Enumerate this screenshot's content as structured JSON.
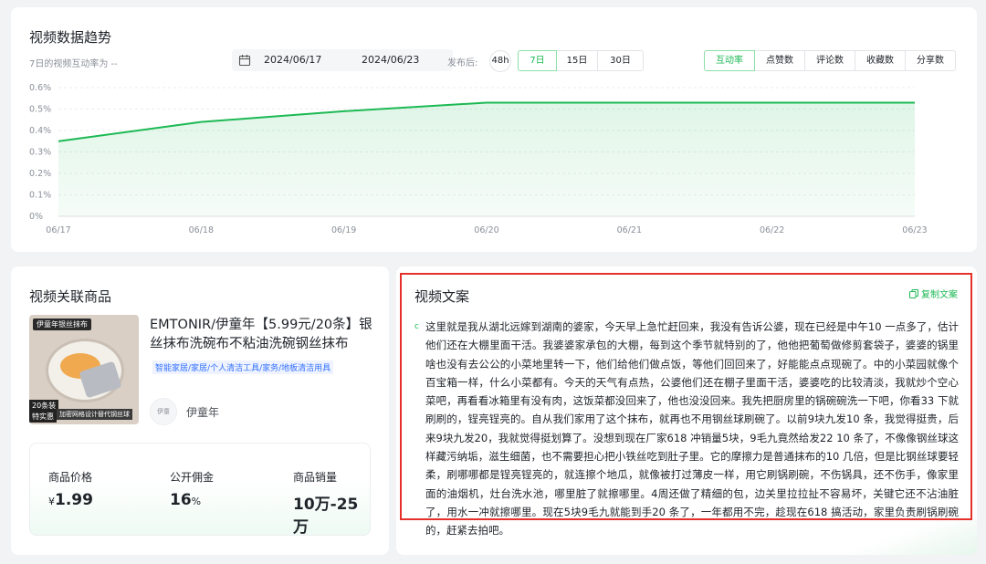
{
  "trend": {
    "title": "视频数据趋势",
    "subtitle": "7日的视频互动率为 --",
    "date_start": "2024/06/17",
    "date_end": "2024/06/23",
    "publish_label": "发布后:",
    "publish_48h": "48h",
    "ranges": [
      "7日",
      "15日",
      "30日"
    ],
    "metrics": [
      "互动率",
      "点赞数",
      "评论数",
      "收藏数",
      "分享数"
    ]
  },
  "chart_data": {
    "type": "area",
    "categories": [
      "06/17",
      "06/18",
      "06/19",
      "06/20",
      "06/21",
      "06/22",
      "06/23"
    ],
    "series": [
      {
        "values": [
          0.35,
          0.44,
          0.49,
          0.53,
          0.53,
          0.53,
          0.53
        ]
      }
    ],
    "y_ticks": [
      "0%",
      "0.1%",
      "0.2%",
      "0.3%",
      "0.4%",
      "0.5%",
      "0.6%"
    ],
    "ylim": [
      0,
      0.6
    ],
    "grid": true,
    "color": "#1db954"
  },
  "product": {
    "title": "视频关联商品",
    "name": "EMTONIR/伊童年【5.99元/20条】银丝抹布洗碗布不粘油洗碗钢丝抹布",
    "category": "智能家居/家居/个人清洁工具/家务/地板清洁用具",
    "thumb": {
      "tag": "伊童年银丝抹布",
      "badge1": "20条装",
      "badge2": "特实惠",
      "badge3": "加密网格设计替代钢丝球"
    },
    "shop_icon_text": "伊童",
    "shop_name": "伊童年",
    "stats": [
      {
        "label": "商品价格",
        "prefix": "¥",
        "value": "1.99",
        "suffix": ""
      },
      {
        "label": "公开佣金",
        "prefix": "",
        "value": "16",
        "suffix": "%"
      },
      {
        "label": "商品销量",
        "prefix": "",
        "value": "10万-25万",
        "suffix": ""
      }
    ]
  },
  "copy": {
    "title": "视频文案",
    "copy_button": "复制文案",
    "dot": "c",
    "text": "这里就是我从湖北远嫁到湖南的婆家，今天早上急忙赶回来，我没有告诉公婆，现在已经是中午10 一点多了，估计他们还在大棚里面干活。我婆婆家承包的大棚，每到这个季节就特别的了，他他把葡萄做修剪套袋子，婆婆的锅里啥也没有去公公的小菜地里转一下，他们给他们做点饭，等他们回回来了，好能能点点现碗了。中的小菜园就像个百宝箱一样，什么小菜都有。今天的天气有点热，公婆他们还在棚子里面干活，婆婆吃的比较清淡，我就炒个空心菜吧，再看看冰箱里有没有肉，这饭菜都没回来了，他也没没回来。我先把厨房里的锅碗碗洗一下吧，你看33 下就刷刷的，锃亮锃亮的。自从我们家用了这个抹布，就再也不用钢丝球刷碗了。以前9块九发10 条，我觉得挺贵，后来9块九发20，我就觉得挺划算了。没想到现在厂家618 冲销量5块，9毛九竟然给发22 10 条了，不像像钢丝球这样藏污纳垢，滋生细菌，也不需要担心把小铁丝吃到肚子里。它的摩擦力是普通抹布的10 几倍，但是比钢丝球要轻柔，刷哪哪都是锃亮锃亮的，就连擦个地瓜，就像被打过薄皮一样，用它刷锅刷碗，不伤锅具，还不伤手，像家里面的油烟机，灶台洗水池，哪里脏了就擦哪里。4周还做了精细的包，边关里拉拉扯不容易坏，关键它还不沾油脏了，用水一冲就擦哪里。现在5块9毛九就能到手20 条了，一年都用不完，趁现在618 搞活动，家里负责刷锅刷碗的，赶紧去拍吧。"
  }
}
